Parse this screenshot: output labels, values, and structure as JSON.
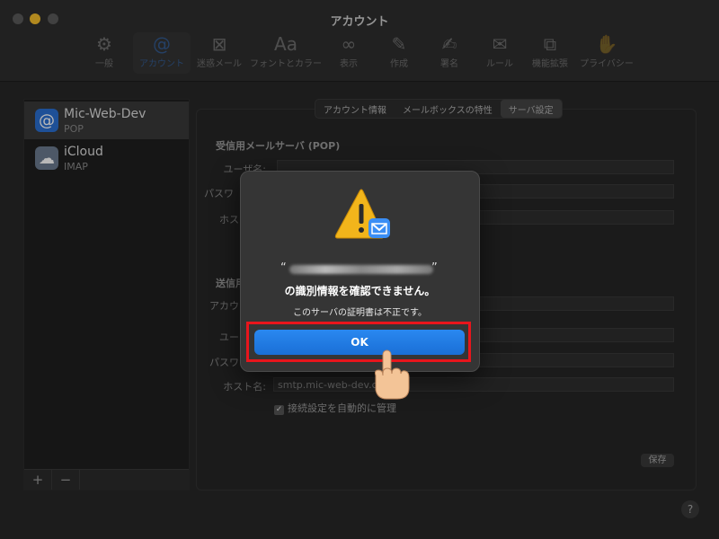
{
  "window": {
    "title": "アカウント"
  },
  "toolbar": {
    "items": [
      {
        "label": "一般",
        "icon": "gear-icon",
        "glyph": "⚙"
      },
      {
        "label": "アカウント",
        "icon": "at-icon",
        "glyph": "@"
      },
      {
        "label": "迷惑メール",
        "icon": "junk-icon",
        "glyph": "⊠"
      },
      {
        "label": "フォントとカラー",
        "icon": "fonts-icon",
        "glyph": "Aa"
      },
      {
        "label": "表示",
        "icon": "glasses-icon",
        "glyph": "∞"
      },
      {
        "label": "作成",
        "icon": "compose-icon",
        "glyph": "✎"
      },
      {
        "label": "署名",
        "icon": "signature-icon",
        "glyph": "✍"
      },
      {
        "label": "ルール",
        "icon": "rules-icon",
        "glyph": "✉"
      },
      {
        "label": "機能拡張",
        "icon": "extensions-icon",
        "glyph": "⧉"
      },
      {
        "label": "プライバシー",
        "icon": "privacy-hand-icon",
        "glyph": "✋"
      }
    ]
  },
  "sidebar": {
    "accounts": [
      {
        "name": "Mic-Web-Dev",
        "type": "POP"
      },
      {
        "name": "iCloud",
        "type": "IMAP"
      }
    ],
    "add_label": "+",
    "remove_label": "−"
  },
  "tabs": [
    "アカウント情報",
    "メールボックスの特性",
    "サーバ設定"
  ],
  "incoming": {
    "heading": "受信用メールサーバ (POP)",
    "username_label": "ユーザ名:",
    "password_label": "パスワ",
    "host_label": "ホス"
  },
  "outgoing": {
    "heading": "送信用",
    "account_label": "アカウ",
    "username_label": "ユー",
    "password_label": "パスワ",
    "host_label": "ホスト名:",
    "host_value": "smtp.mic-web-dev.c",
    "auto_manage_label": "接続設定を自動的に管理",
    "checkmark": "✓"
  },
  "save_label": "保存",
  "help_label": "?",
  "dialog": {
    "quote_open": "“",
    "quote_close": "”",
    "title": "の識別情報を確認できません。",
    "message": "このサーバの証明書は不正です。",
    "ok_label": "OK"
  },
  "colors": {
    "accent": "#1a6fd6",
    "highlight_box": "#e8151c",
    "warning": "#f2b51b"
  }
}
